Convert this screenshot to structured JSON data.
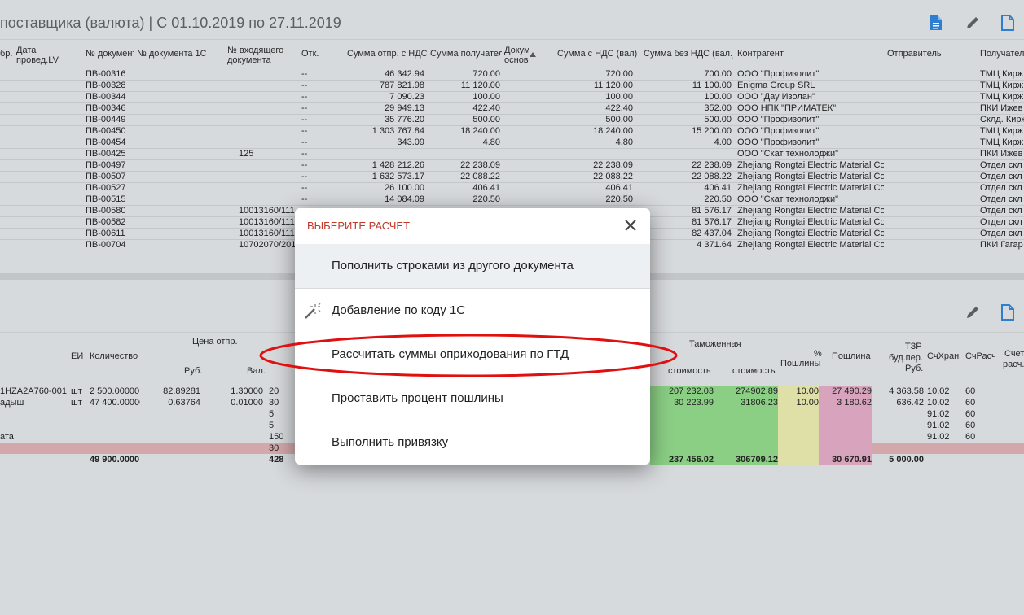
{
  "title": "поставщика (валюта) | С 01.10.2019 по 27.11.2019",
  "top_columns": [
    "бр.",
    "Дата провед.LV",
    "№ документ",
    "№ документа 1С",
    "№ входящего документа",
    "Отк.",
    "Сумма отпр. с НДС",
    "Сумма получатель",
    "Докум основ",
    "Сумма с НДС (вал)",
    "Сумма без НДС (вал.)",
    "Контрагент",
    "Отправитель",
    "Получатель"
  ],
  "top_rows": [
    {
      "doc": "ПВ-00316",
      "in": "",
      "otk": "--",
      "s1": "46 342.94",
      "s2": "720.00",
      "s3": "720.00",
      "s4": "700.00",
      "agent": "ООО \"Профизолит\"",
      "recv": "ТМЦ Кирж"
    },
    {
      "doc": "ПВ-00328",
      "in": "",
      "otk": "--",
      "s1": "787 821.98",
      "s2": "11 120.00",
      "s3": "11 120.00",
      "s4": "11 100.00",
      "agent": "Enigma Group SRL",
      "recv": "ТМЦ Кирж"
    },
    {
      "doc": "ПВ-00344",
      "in": "",
      "otk": "--",
      "s1": "7 090.23",
      "s2": "100.00",
      "s3": "100.00",
      "s4": "100.00",
      "agent": "ООО \"Дау Изолан\"",
      "recv": "ТМЦ Кирж"
    },
    {
      "doc": "ПВ-00346",
      "in": "",
      "otk": "--",
      "s1": "29 949.13",
      "s2": "422.40",
      "s3": "422.40",
      "s4": "352.00",
      "agent": "ООО НПК \"ПРИМАТЕК\"",
      "recv": "ПКИ Ижев"
    },
    {
      "doc": "ПВ-00449",
      "in": "",
      "otk": "--",
      "s1": "35 776.20",
      "s2": "500.00",
      "s3": "500.00",
      "s4": "500.00",
      "agent": "ООО \"Профизолит\"",
      "recv": "Склд. Кирж"
    },
    {
      "doc": "ПВ-00450",
      "in": "",
      "otk": "--",
      "s1": "1 303 767.84",
      "s2": "18 240.00",
      "s3": "18 240.00",
      "s4": "15 200.00",
      "agent": "ООО \"Профизолит\"",
      "recv": "ТМЦ Кирж"
    },
    {
      "doc": "ПВ-00454",
      "in": "",
      "otk": "--",
      "s1": "343.09",
      "s2": "4.80",
      "s3": "4.80",
      "s4": "4.00",
      "agent": "ООО \"Профизолит\"",
      "recv": "ТМЦ Кирж"
    },
    {
      "doc": "ПВ-00425",
      "in": "125",
      "otk": "--",
      "s1": "",
      "s2": "",
      "s3": "",
      "s4": "",
      "agent": "ООО \"Скат технолоджи\"",
      "recv": "ПКИ Ижев"
    },
    {
      "doc": "ПВ-00497",
      "in": "",
      "otk": "--",
      "s1": "1 428 212.26",
      "s2": "22 238.09",
      "s3": "22 238.09",
      "s4": "22 238.09",
      "agent": "Zhejiang Rongtai Electric Material Co.,",
      "recv": "Отдел скл"
    },
    {
      "doc": "ПВ-00507",
      "in": "",
      "otk": "--",
      "s1": "1 632 573.17",
      "s2": "22 088.22",
      "s3": "22 088.22",
      "s4": "22 088.22",
      "agent": "Zhejiang Rongtai Electric Material Co.,",
      "recv": "Отдел скл"
    },
    {
      "doc": "ПВ-00527",
      "in": "",
      "otk": "--",
      "s1": "26 100.00",
      "s2": "406.41",
      "s3": "406.41",
      "s4": "406.41",
      "agent": "Zhejiang Rongtai Electric Material Co.,",
      "recv": "Отдел скл"
    },
    {
      "doc": "ПВ-00515",
      "in": "",
      "otk": "--",
      "s1": "14 084.09",
      "s2": "220.50",
      "s3": "220.50",
      "s4": "220.50",
      "agent": "ООО \"Скат технолоджи\"",
      "recv": "Отдел скл"
    },
    {
      "doc": "ПВ-00580",
      "in": "10013160/111",
      "otk": "--",
      "s1": "",
      "s2": "",
      "s3": "",
      "s4": "81 576.17",
      "agent": "Zhejiang Rongtai Electric Material Co.,",
      "recv": "Отдел скл"
    },
    {
      "doc": "ПВ-00582",
      "in": "10013160/111",
      "otk": "--",
      "s1": "",
      "s2": "",
      "s3": "",
      "s4": "81 576.17",
      "agent": "Zhejiang Rongtai Electric Material Co.,",
      "recv": "Отдел скл"
    },
    {
      "doc": "ПВ-00611",
      "in": "10013160/111",
      "otk": "--",
      "s1": "",
      "s2": "",
      "s3": "",
      "s4": "82 437.04",
      "agent": "Zhejiang Rongtai Electric Material Co.,",
      "recv": "Отдел скл"
    },
    {
      "doc": "ПВ-00704",
      "in": "10702070/201",
      "otk": "--",
      "s1": "",
      "s2": "",
      "s3": "",
      "s4": "4 371.64",
      "agent": "Zhejiang Rongtai Electric Material Co.,",
      "recv": "ПКИ Гагар"
    }
  ],
  "bottom_headers": {
    "ei": "ЕИ",
    "qty": "Количество",
    "price": "Цена отпр.",
    "rub": "Руб.",
    "val": "Вал.",
    "customs": "Таможенная",
    "cost1": "стоимость",
    "cost2": "стоимость",
    "pct": "%",
    "pct2": "Пошлины",
    "duty": "Пошлина",
    "tzr": "ТЗР",
    "tzr2": "буд.пер.",
    "tzr3": "Руб.",
    "store": "СчХран",
    "calc": "СчРасч",
    "acc": "Счет",
    "acc2": "расч."
  },
  "bottom_rows": [
    {
      "name": "1HZA2A760-001",
      "ei": "шт",
      "qty": "2 500.00000",
      "rub": "82.89281",
      "val": "1.30000",
      "x": "20",
      "c1": "207 232.03",
      "c2": "274902.89",
      "pct": "10.00",
      "duty": "27 490.29",
      "tzr": "4 363.58",
      "store": "10.02",
      "calc": "60"
    },
    {
      "name": "адыш",
      "ei": "шт",
      "qty": "47 400.00000",
      "rub": "0.63764",
      "val": "0.01000",
      "x": "30",
      "c1": "30 223.99",
      "c2": "31806.23",
      "pct": "10.00",
      "duty": "3 180.62",
      "tzr": "636.42",
      "store": "10.02",
      "calc": "60"
    },
    {
      "name": "",
      "ei": "",
      "qty": "",
      "rub": "",
      "val": "",
      "x": "5",
      "c1": "",
      "c2": "",
      "pct": "",
      "duty": "",
      "tzr": "",
      "store": "91.02",
      "calc": "60"
    },
    {
      "name": "",
      "ei": "",
      "qty": "",
      "rub": "",
      "val": "",
      "x": "5",
      "c1": "",
      "c2": "",
      "pct": "",
      "duty": "",
      "tzr": "",
      "store": "91.02",
      "calc": "60"
    },
    {
      "name": "ата",
      "ei": "",
      "qty": "",
      "rub": "",
      "val": "",
      "x": "150",
      "c1": "",
      "c2": "",
      "pct": "",
      "duty": "",
      "tzr": "",
      "store": "91.02",
      "calc": "60"
    },
    {
      "name": "",
      "ei": "",
      "qty": "",
      "rub": "",
      "val": "",
      "x": "30",
      "c1": "",
      "c2": "",
      "pct": "",
      "duty": "",
      "tzr": "",
      "store": "",
      "calc": ""
    }
  ],
  "bottom_total": {
    "qty": "49 900.0000",
    "x": "428",
    "c1": "237 456.02",
    "c2": "306709.12",
    "duty": "30 670.91",
    "tzr": "5 000.00"
  },
  "modal": {
    "title": "ВЫБЕРИТЕ РАСЧЕТ",
    "items": [
      "Пополнить строками из другого документа",
      "Добавление по коду 1С",
      "Рассчитать суммы оприходования по ГТД",
      "Проставить процент пошлины",
      "Выполнить привязку"
    ]
  },
  "icons": {
    "doc_color": "#2f7fd0",
    "pencil_color": "#5a5f63",
    "ellipse_color": "#e01010"
  }
}
